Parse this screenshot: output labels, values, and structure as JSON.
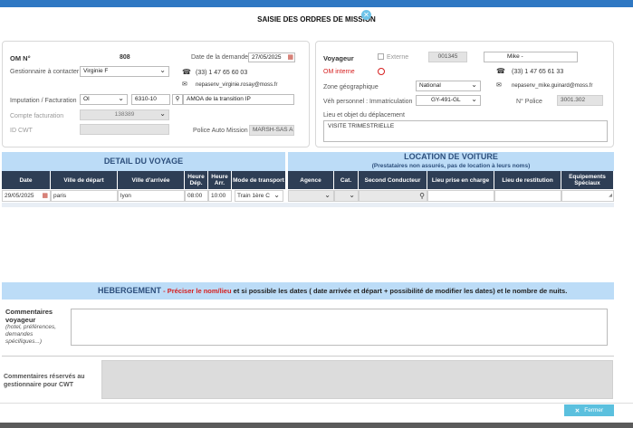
{
  "page_title": "SAISIE DES ORDRES DE MISSION",
  "left": {
    "om_label": "OM N°",
    "om_value": "808",
    "date_label": "Date de la demande",
    "date_value": "27/05/2025",
    "gestionnaire_label": "Gestionnaire à contacter",
    "gestionnaire_value": "Virginie F",
    "phone": "(33) 1 47 65 60 03",
    "email": "nepasenv_virginie.rosay@moss.fr",
    "imputation_label": "Imputation / Facturation",
    "imputation_select": "OI",
    "imputation_code": "6310-10",
    "imputation_desc": "AMOA de la transition IP",
    "compte_label": "Compte facturation",
    "compte_value": "138389",
    "idcwt_label": "ID CWT",
    "idcwt_value": "",
    "police_label": "Police Auto Mission",
    "police_value": "MARSH-SAS AI"
  },
  "right": {
    "voyageur_label": "Voyageur",
    "externe_label": "Externe",
    "voyageur_id": "001345",
    "voyageur_name": "Mike -",
    "om_interne_label": "OM interne",
    "phone": "(33) 1 47 65 61 33",
    "zone_label": "Zone géographique",
    "zone_value": "National",
    "email": "nepasenv_mike.guinard@moss.fr",
    "veh_label": "Véh personnel : Immatriculation",
    "veh_value": "GY-491-GL",
    "npolice_label": "N° Police",
    "npolice_value": "3001.302",
    "lieu_label": "Lieu et objet du déplacement",
    "lieu_value": "VISITE TRIMESTRIELLE"
  },
  "voyage": {
    "title": "DETAIL DU VOYAGE",
    "headers": [
      "Date",
      "Ville de départ",
      "Ville d'arrivée",
      "Heure Dép.",
      "Heure Arr.",
      "Mode de transport"
    ],
    "row": {
      "date": "29/05/2025",
      "depart": "paris",
      "arrivee": "lyon",
      "heure_dep": "08:00",
      "heure_arr": "10:00",
      "mode": "Train 1ère C"
    }
  },
  "location": {
    "title": "LOCATION DE VOITURE",
    "subtitle": "(Prestataires non assurés, pas de location à leurs noms)",
    "headers": [
      "Agence",
      "Cat.",
      "Second Conducteur",
      "Lieu prise en charge",
      "Lieu de restitution",
      "Equipements Spéciaux"
    ]
  },
  "hebergement": {
    "title": "HEBERGEMENT",
    "sep": " - ",
    "red_text": "Préciser le nom/lieu",
    "rest_text": " et si possible les dates ( date arrivée et départ + possibilité de modifier les dates) et le nombre de nuits."
  },
  "commentaires": {
    "label": "Commentaires voyageur",
    "hint": "(hotel, préférences, demandes spécifiques...)",
    "value": ""
  },
  "commentaires_cwt": {
    "label": "Commentaires réservés au gestionnaire pour CWT",
    "value": ""
  },
  "close_button": "Fermer",
  "icons": [
    "close-circle-icon",
    "calendar-icon",
    "phone-icon",
    "mail-icon",
    "search-icon",
    "chevron-down-icon",
    "radio-icon",
    "checkbox-icon",
    "resize-icon"
  ],
  "colors": {
    "topbar": "#2f78c3",
    "section_header": "#bcdcf7",
    "table_header": "#2e3e55",
    "button": "#5bc0de",
    "red": "#d62020"
  }
}
